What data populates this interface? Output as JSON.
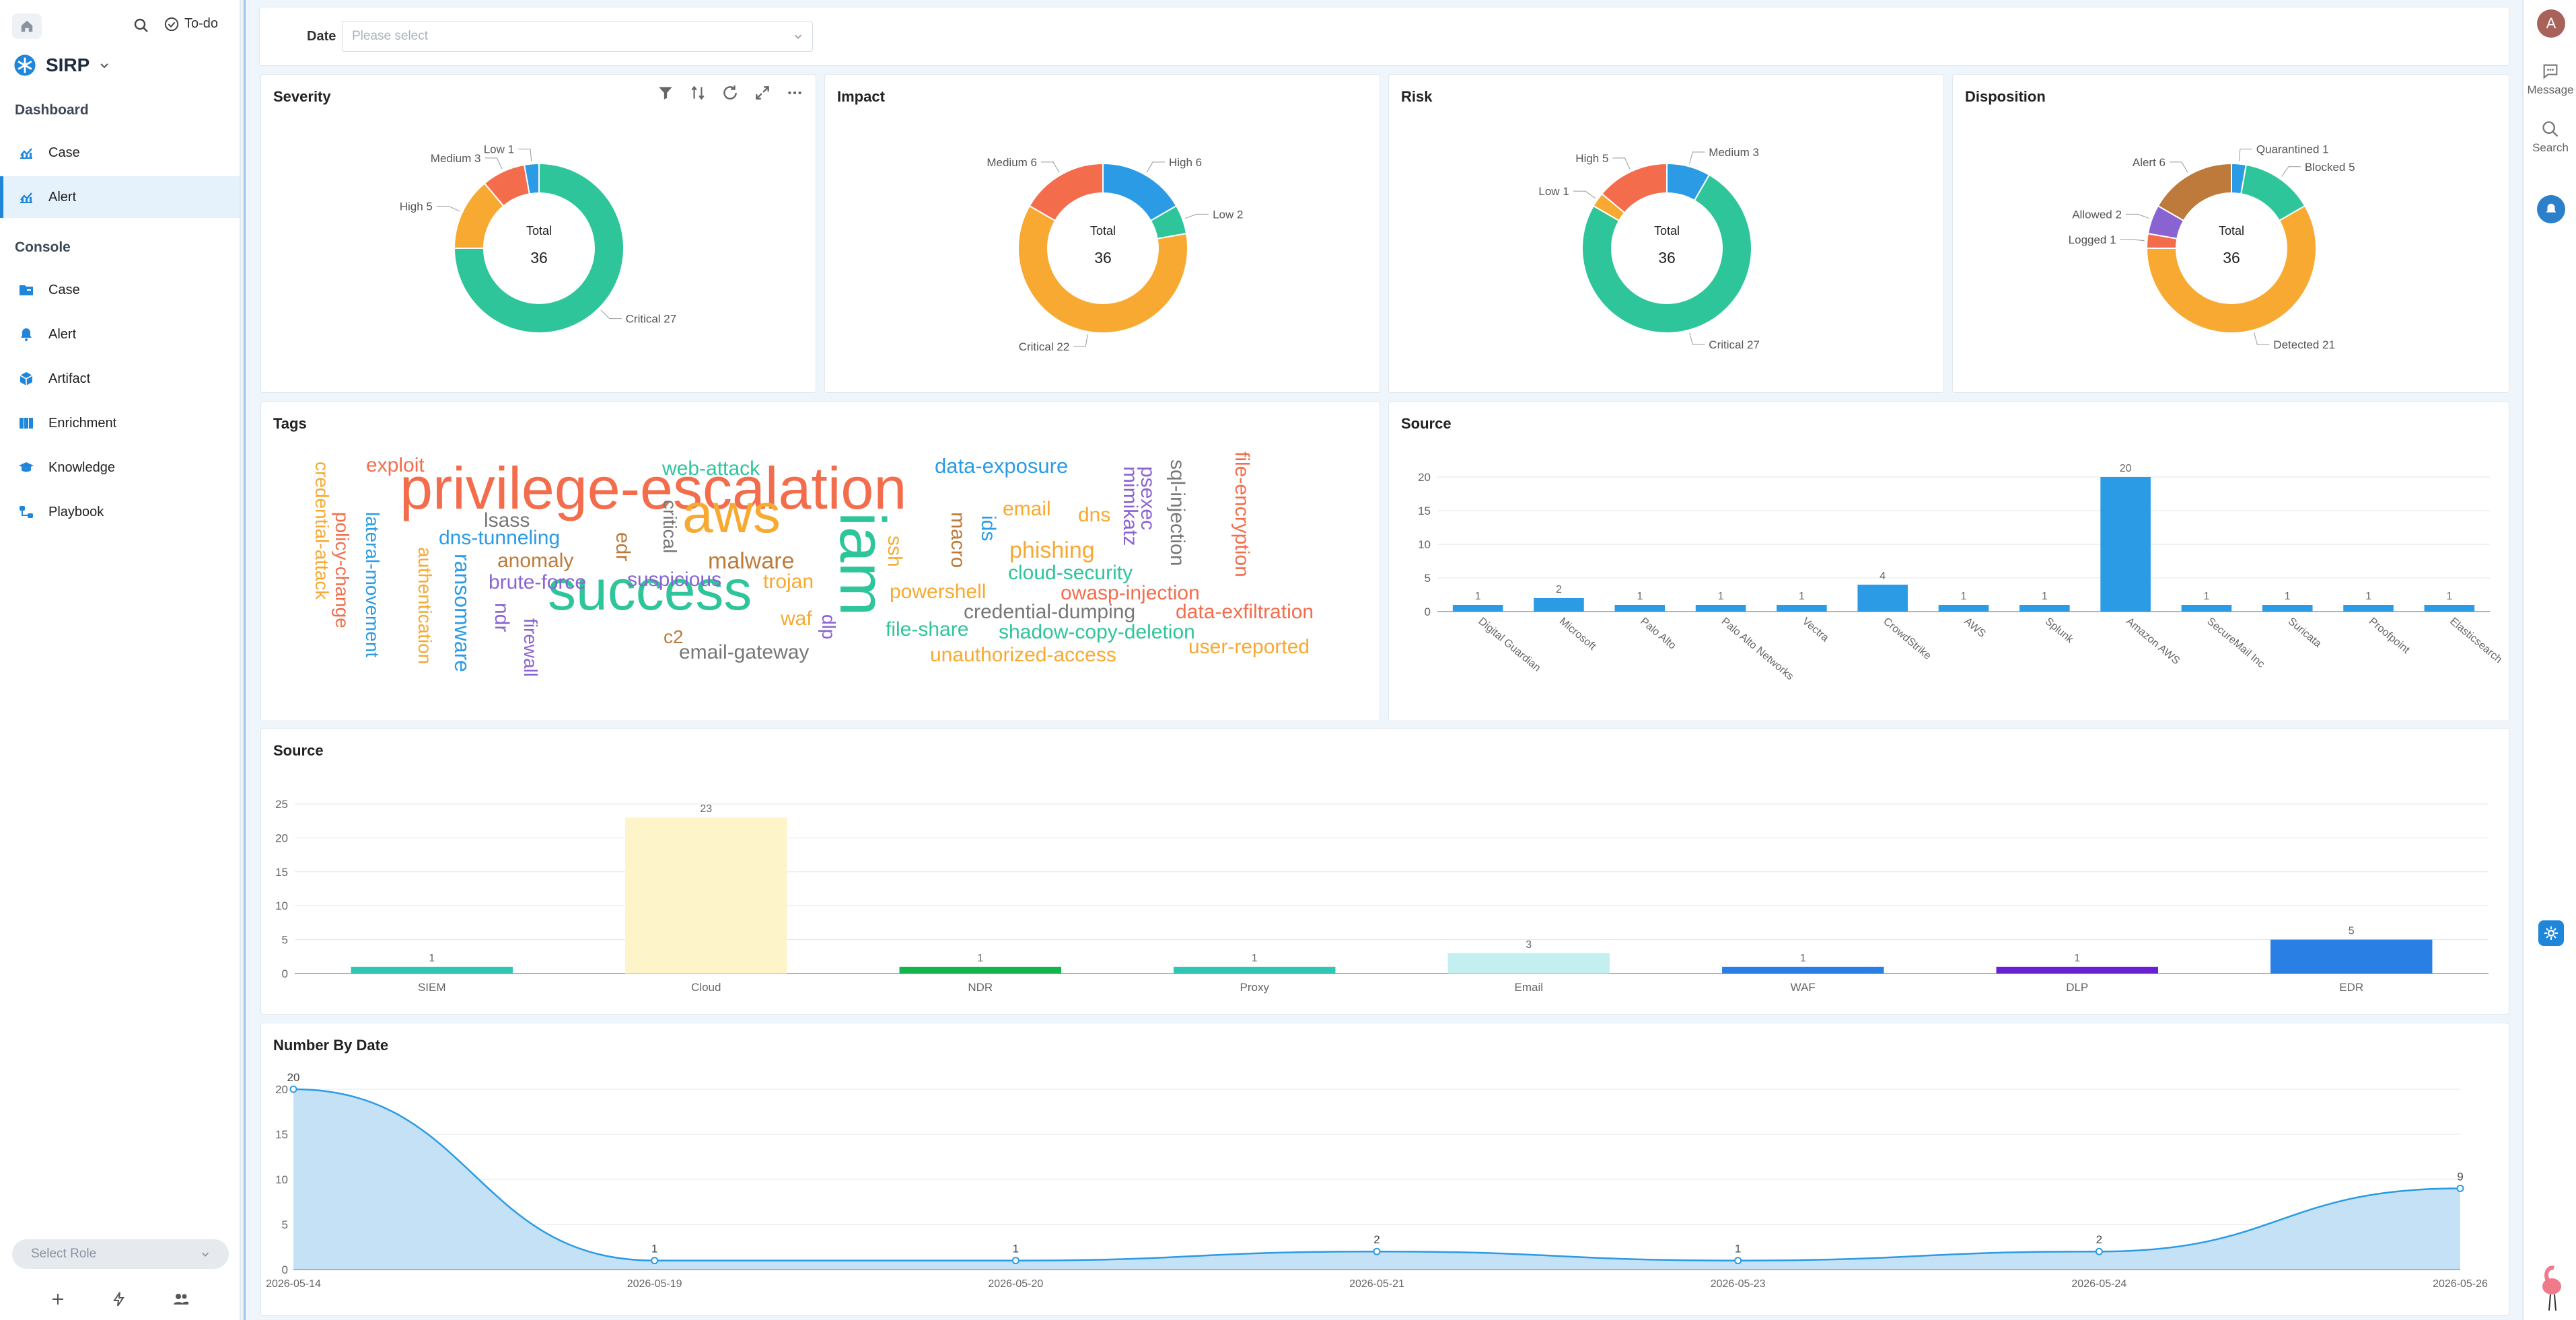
{
  "app": {
    "name": "SIRP",
    "avatar": "A",
    "todo_label": "To-do"
  },
  "sidebar": {
    "sections": [
      {
        "title": "Dashboard",
        "items": [
          {
            "label": "Case",
            "icon": "chart-icon"
          },
          {
            "label": "Alert",
            "icon": "chart-icon",
            "active": true
          }
        ]
      },
      {
        "title": "Console",
        "items": [
          {
            "label": "Case",
            "icon": "folder-icon"
          },
          {
            "label": "Alert",
            "icon": "bell-icon"
          },
          {
            "label": "Artifact",
            "icon": "cube-icon"
          },
          {
            "label": "Enrichment",
            "icon": "book-icon"
          },
          {
            "label": "Knowledge",
            "icon": "graduation-cap-icon"
          },
          {
            "label": "Playbook",
            "icon": "flow-icon"
          }
        ]
      }
    ],
    "select_role": "Select Role"
  },
  "rightbar": {
    "message_label": "Message",
    "search_label": "Search"
  },
  "filter": {
    "label": "Date",
    "placeholder": "Please select"
  },
  "colors": {
    "accent": "#1f86d9",
    "green": "#2ec59b",
    "orange": "#f7a931",
    "red": "#f36d4c",
    "blue": "#2a9be4"
  },
  "chart_data": [
    {
      "type": "pie",
      "title": "Severity",
      "center_label": "Total",
      "total": 36,
      "slices": [
        {
          "name": "Critical",
          "value": 27,
          "color": "#2ec59b"
        },
        {
          "name": "High",
          "value": 5,
          "color": "#f7a931"
        },
        {
          "name": "Medium",
          "value": 3,
          "color": "#f36d4c"
        },
        {
          "name": "Low",
          "value": 1,
          "color": "#2a9be4"
        }
      ]
    },
    {
      "type": "pie",
      "title": "Impact",
      "center_label": "Total",
      "total": 36,
      "slices": [
        {
          "name": "High",
          "value": 6,
          "color": "#2a9be4"
        },
        {
          "name": "Low",
          "value": 2,
          "color": "#2ec59b"
        },
        {
          "name": "Critical",
          "value": 22,
          "color": "#f7a931"
        },
        {
          "name": "Medium",
          "value": 6,
          "color": "#f36d4c"
        }
      ]
    },
    {
      "type": "pie",
      "title": "Risk",
      "center_label": "Total",
      "total": 36,
      "slices": [
        {
          "name": "Medium",
          "value": 3,
          "color": "#2a9be4"
        },
        {
          "name": "Critical",
          "value": 27,
          "color": "#2ec59b"
        },
        {
          "name": "Low",
          "value": 1,
          "color": "#f7a931"
        },
        {
          "name": "High",
          "value": 5,
          "color": "#f36d4c"
        }
      ]
    },
    {
      "type": "pie",
      "title": "Disposition",
      "center_label": "Total",
      "total": 36,
      "slices": [
        {
          "name": "Quarantined",
          "value": 1,
          "color": "#2a9be4"
        },
        {
          "name": "Blocked",
          "value": 5,
          "color": "#2ec59b"
        },
        {
          "name": "Detected",
          "value": 21,
          "color": "#f7a931"
        },
        {
          "name": "Logged",
          "value": 1,
          "color": "#f36d4c"
        },
        {
          "name": "Allowed",
          "value": 2,
          "color": "#8a63d2"
        },
        {
          "name": "Alert",
          "value": 6,
          "color": "#bd7a3a"
        }
      ]
    },
    {
      "type": "bar",
      "title": "Source",
      "categories": [
        "Digital Guardian",
        "Microsoft",
        "Palo Alto",
        "Palo Alto Networks",
        "Vectra",
        "CrowdStrike",
        "AWS",
        "Splunk",
        "Amazon AWS",
        "SecureMail Inc",
        "Suricata",
        "Proofpoint",
        "Elasticsearch"
      ],
      "values": [
        1,
        2,
        1,
        1,
        1,
        4,
        1,
        1,
        20,
        1,
        1,
        1,
        1
      ],
      "ylim": [
        0,
        20
      ],
      "yticks": [
        0,
        5,
        10,
        15,
        20
      ],
      "color": "#2a9be4"
    },
    {
      "type": "bar",
      "title": "Source",
      "categories": [
        "SIEM",
        "Cloud",
        "NDR",
        "Proxy",
        "Email",
        "WAF",
        "DLP",
        "EDR"
      ],
      "values": [
        1,
        23,
        1,
        1,
        3,
        1,
        1,
        5
      ],
      "colors": [
        "#2fc7b4",
        "#fdf5c9",
        "#12b44b",
        "#2fc7b4",
        "#c3eff0",
        "#2a7fe4",
        "#6a1fd2",
        "#2a7fe4"
      ],
      "ylim": [
        0,
        25
      ],
      "yticks": [
        0,
        5,
        10,
        15,
        20,
        25
      ]
    },
    {
      "type": "area",
      "title": "Number By Date",
      "x": [
        "2026-05-14",
        "2026-05-19",
        "2026-05-20",
        "2026-05-21",
        "2026-05-23",
        "2026-05-24",
        "2026-05-26"
      ],
      "values": [
        20,
        1,
        1,
        2,
        1,
        2,
        9
      ],
      "ylim": [
        0,
        20
      ],
      "yticks": [
        0,
        5,
        10,
        15,
        20
      ],
      "color": "#2a9be4"
    }
  ],
  "tags": {
    "title": "Tags",
    "words": [
      {
        "t": "privilege-escalation",
        "c": "#f36d4c"
      },
      {
        "t": "aws",
        "c": "#f7a931"
      },
      {
        "t": "success",
        "c": "#2ec59b"
      },
      {
        "t": "iam",
        "c": "#2ec59b"
      },
      {
        "t": "exploit",
        "c": "#f36d4c"
      },
      {
        "t": "web-attack",
        "c": "#2ec59b"
      },
      {
        "t": "data-exposure",
        "c": "#2a9be4"
      },
      {
        "t": "credential-attack",
        "c": "#f7a931"
      },
      {
        "t": "policy-change",
        "c": "#f36d4c"
      },
      {
        "t": "lateral-movement",
        "c": "#2a9be4"
      },
      {
        "t": "lsass",
        "c": "#777777"
      },
      {
        "t": "dns-tunneling",
        "c": "#2a9be4"
      },
      {
        "t": "authentication",
        "c": "#f7a931"
      },
      {
        "t": "ransomware",
        "c": "#2a9be4"
      },
      {
        "t": "anomaly",
        "c": "#bd7a3a"
      },
      {
        "t": "brute-force",
        "c": "#8a63d2"
      },
      {
        "t": "ndr",
        "c": "#8a63d2"
      },
      {
        "t": "firewall",
        "c": "#8a63d2"
      },
      {
        "t": "edr",
        "c": "#bd7a3a"
      },
      {
        "t": "critical",
        "c": "#777777"
      },
      {
        "t": "suspicious",
        "c": "#8a63d2"
      },
      {
        "t": "malware",
        "c": "#bd7a3a"
      },
      {
        "t": "c2",
        "c": "#bd7a3a"
      },
      {
        "t": "email-gateway",
        "c": "#777777"
      },
      {
        "t": "trojan",
        "c": "#f7a931"
      },
      {
        "t": "waf",
        "c": "#f7a931"
      },
      {
        "t": "dlp",
        "c": "#8a63d2"
      },
      {
        "t": "ssh",
        "c": "#f7a931"
      },
      {
        "t": "powershell",
        "c": "#f7a931"
      },
      {
        "t": "file-share",
        "c": "#2ec59b"
      },
      {
        "t": "unauthorized-access",
        "c": "#f7a931"
      },
      {
        "t": "macro",
        "c": "#bd7a3a"
      },
      {
        "t": "ids",
        "c": "#2a9be4"
      },
      {
        "t": "email",
        "c": "#f7a931"
      },
      {
        "t": "phishing",
        "c": "#f7a931"
      },
      {
        "t": "cloud-security",
        "c": "#2ec59b"
      },
      {
        "t": "credential-dumping",
        "c": "#777777"
      },
      {
        "t": "shadow-copy-deletion",
        "c": "#2ec59b"
      },
      {
        "t": "dns",
        "c": "#f7a931"
      },
      {
        "t": "mimikatz",
        "c": "#8a63d2"
      },
      {
        "t": "psexec",
        "c": "#8a63d2"
      },
      {
        "t": "sql-injection",
        "c": "#777777"
      },
      {
        "t": "owasp-injection",
        "c": "#f36d4c"
      },
      {
        "t": "file-encryption",
        "c": "#f36d4c"
      },
      {
        "t": "data-exfiltration",
        "c": "#f36d4c"
      },
      {
        "t": "user-reported",
        "c": "#f7a931"
      }
    ]
  }
}
